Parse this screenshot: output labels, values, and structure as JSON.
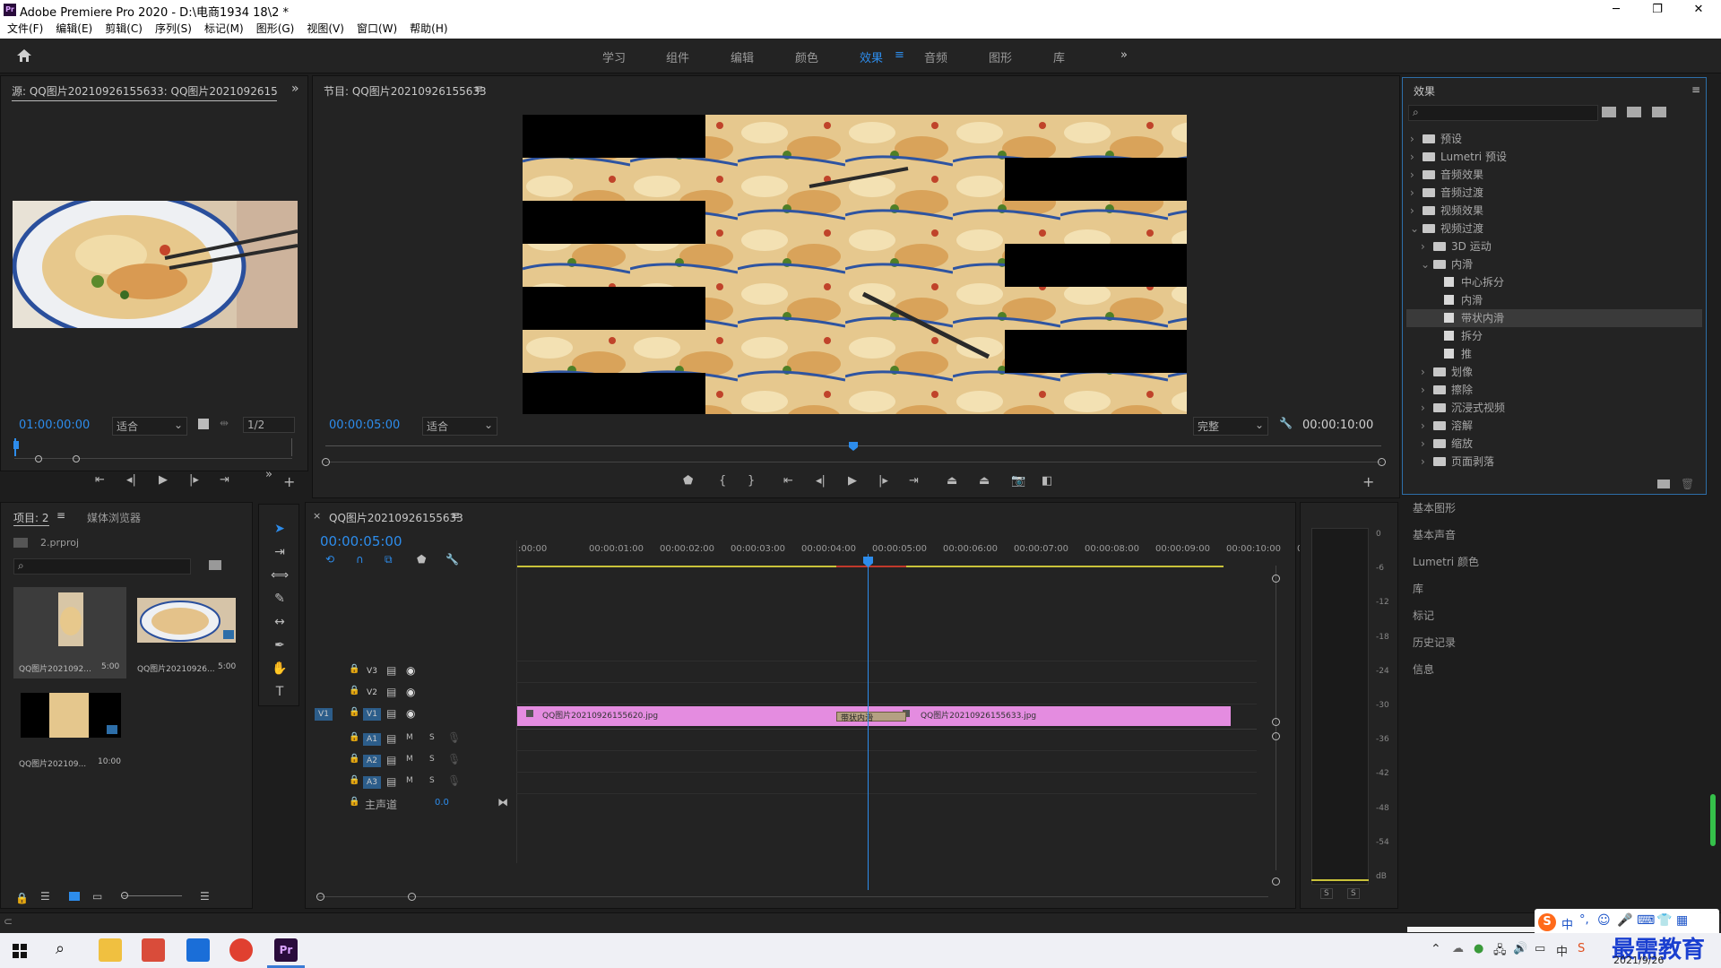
{
  "window": {
    "title": "Adobe Premiere Pro 2020 - D:\\电商1934 18\\2 *"
  },
  "menu": [
    "文件(F)",
    "编辑(E)",
    "剪辑(C)",
    "序列(S)",
    "标记(M)",
    "图形(G)",
    "视图(V)",
    "窗口(W)",
    "帮助(H)"
  ],
  "workspaces": {
    "tabs": [
      "学习",
      "组件",
      "编辑",
      "颜色",
      "效果",
      "音频",
      "图形",
      "库"
    ],
    "active": "效果"
  },
  "source": {
    "title": "源: QQ图片20210926155633: QQ图片20210926155633.",
    "timecode": "01:00:00:00",
    "fit": "适合",
    "resolution": "1/2"
  },
  "program": {
    "title": "节目: QQ图片20210926155633",
    "timecode": "00:00:05:00",
    "fit": "适合",
    "quality": "完整",
    "duration": "00:00:10:00",
    "playhead": 0.5
  },
  "effects": {
    "title": "效果",
    "search_placeholder": "",
    "tree": [
      {
        "label": "预设",
        "depth": 0,
        "kind": "folder-special",
        "open": false
      },
      {
        "label": "Lumetri 预设",
        "depth": 0,
        "kind": "folder-special",
        "open": false
      },
      {
        "label": "音频效果",
        "depth": 0,
        "kind": "folder",
        "open": false
      },
      {
        "label": "音频过渡",
        "depth": 0,
        "kind": "folder",
        "open": false
      },
      {
        "label": "视频效果",
        "depth": 0,
        "kind": "folder",
        "open": false
      },
      {
        "label": "视频过渡",
        "depth": 0,
        "kind": "folder",
        "open": true
      },
      {
        "label": "3D 运动",
        "depth": 1,
        "kind": "folder",
        "open": false
      },
      {
        "label": "内滑",
        "depth": 1,
        "kind": "folder",
        "open": true
      },
      {
        "label": "中心拆分",
        "depth": 2,
        "kind": "effect"
      },
      {
        "label": "内滑",
        "depth": 2,
        "kind": "effect"
      },
      {
        "label": "带状内滑",
        "depth": 2,
        "kind": "effect",
        "selected": true
      },
      {
        "label": "拆分",
        "depth": 2,
        "kind": "effect"
      },
      {
        "label": "推",
        "depth": 2,
        "kind": "effect"
      },
      {
        "label": "划像",
        "depth": 1,
        "kind": "folder",
        "open": false
      },
      {
        "label": "擦除",
        "depth": 1,
        "kind": "folder",
        "open": false
      },
      {
        "label": "沉浸式视频",
        "depth": 1,
        "kind": "folder",
        "open": false
      },
      {
        "label": "溶解",
        "depth": 1,
        "kind": "folder",
        "open": false
      },
      {
        "label": "缩放",
        "depth": 1,
        "kind": "folder",
        "open": false
      },
      {
        "label": "页面剥落",
        "depth": 1,
        "kind": "folder",
        "open": false
      }
    ]
  },
  "side_panels": [
    "基本图形",
    "基本声音",
    "Lumetri 颜色",
    "库",
    "标记",
    "历史记录",
    "信息"
  ],
  "project": {
    "tab_label": "项目: 2",
    "tab_browser": "媒体浏览器",
    "file": "2.prproj",
    "items": [
      {
        "name": "QQ图片2021092...",
        "duration": "5:00"
      },
      {
        "name": "QQ图片20210926...",
        "duration": "5:00"
      },
      {
        "name": "QQ图片202109...",
        "duration": "10:00"
      }
    ]
  },
  "timeline": {
    "tab": "QQ图片20210926155633",
    "timecode": "00:00:05:00",
    "ruler": [
      ":00:00",
      "00:00:01:00",
      "00:00:02:00",
      "00:00:03:00",
      "00:00:04:00",
      "00:00:05:00",
      "00:00:06:00",
      "00:00:07:00",
      "00:00:08:00",
      "00:00:09:00",
      "00:00:10:00",
      "0"
    ],
    "tracks_video": [
      {
        "name": "V3"
      },
      {
        "name": "V2"
      },
      {
        "name": "V1",
        "source": "V1"
      }
    ],
    "tracks_audio": [
      {
        "name": "A1",
        "m": "M",
        "s": "S"
      },
      {
        "name": "A2",
        "m": "M",
        "s": "S"
      },
      {
        "name": "A3",
        "m": "M",
        "s": "S"
      }
    ],
    "master": {
      "label": "主声道",
      "value": "0.0"
    },
    "clips": [
      {
        "name": "QQ图片20210926155620.jpg"
      },
      {
        "name": "QQ图片20210926155633.jpg"
      }
    ],
    "transition": "带状内滑",
    "clip_color": "#e48ce0"
  },
  "meter": {
    "scale": [
      "0",
      "-6",
      "-12",
      "-18",
      "-24",
      "-30",
      "-36",
      "-42",
      "-48",
      "-54",
      "dB"
    ],
    "solo": [
      "S",
      "S"
    ]
  },
  "taskbar": {
    "brand": "最需教育",
    "date": "2021/9/26",
    "ime": "中"
  },
  "colors": {
    "accent": "#2d8ceb",
    "clip": "#e48ce0",
    "selection": "#3a3a3a"
  }
}
